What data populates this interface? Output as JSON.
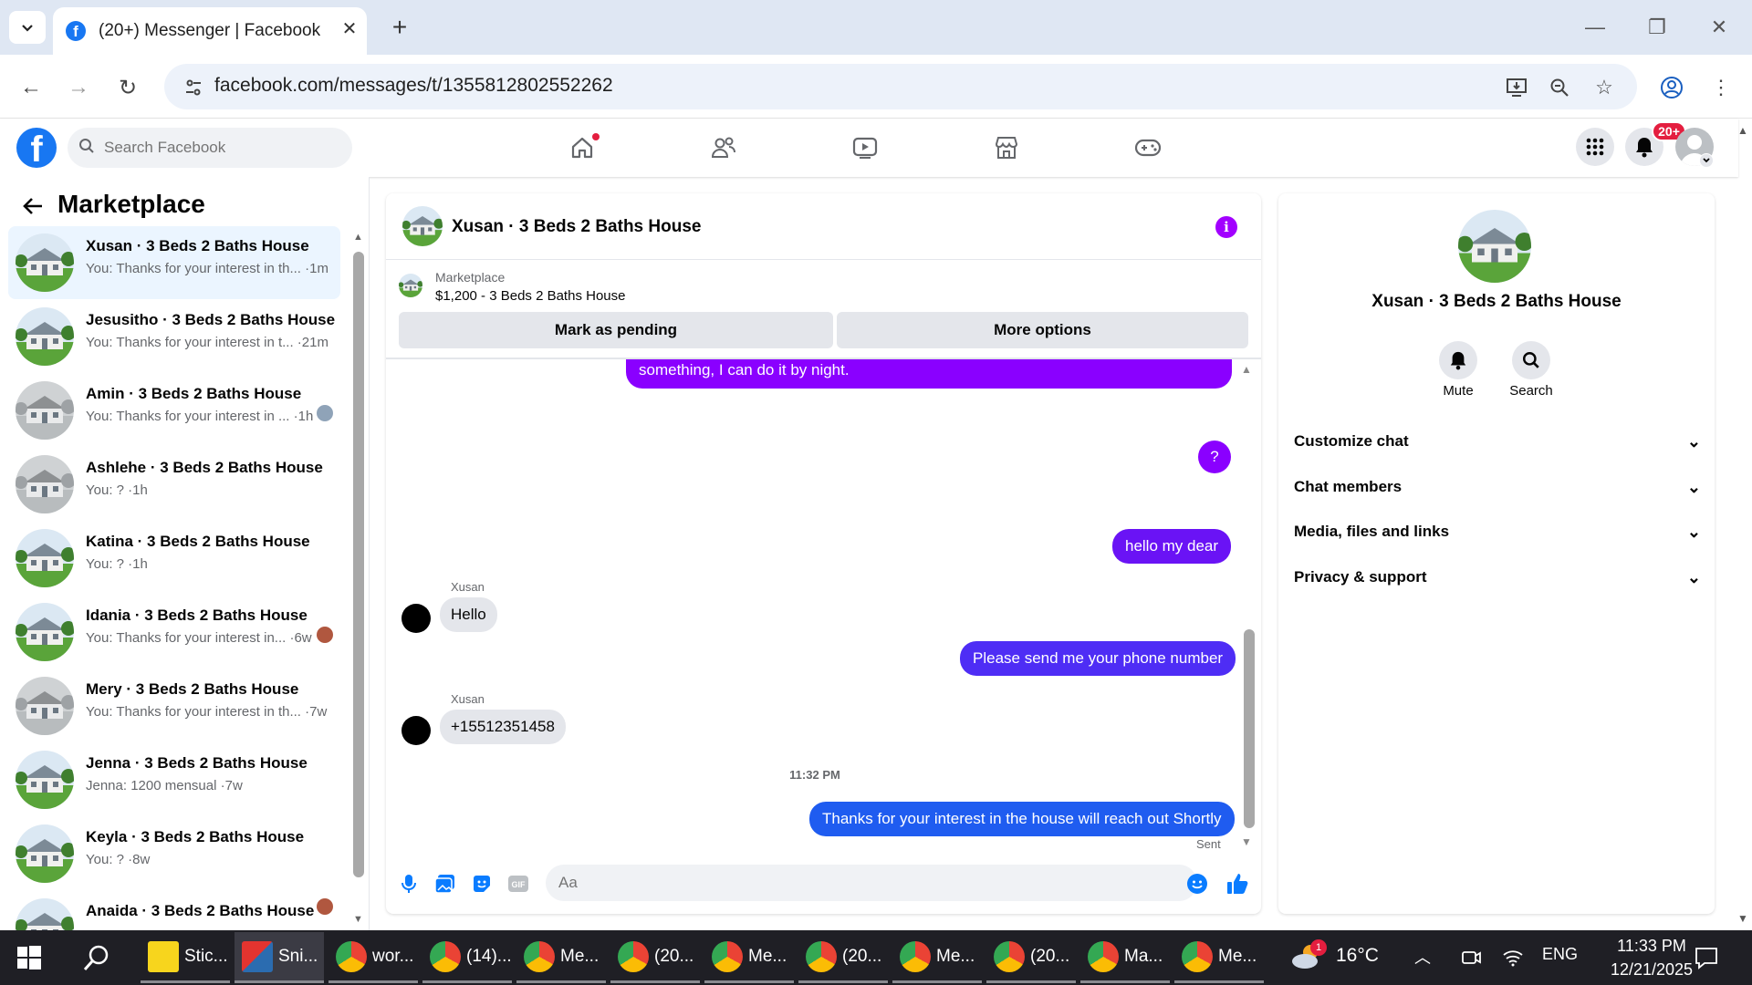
{
  "browser": {
    "tab_title": "(20+) Messenger | Facebook",
    "url": "facebook.com/messages/t/1355812802552262",
    "icons": [
      "tab-list-icon",
      "close-icon",
      "plus-icon",
      "minimize-icon",
      "restore-icon",
      "window-close-icon",
      "back-icon",
      "forward-icon",
      "reload-icon",
      "site-info-icon",
      "install-app-icon",
      "zoom-icon",
      "bookmark-star-icon",
      "profile-icon",
      "menu-kebab-icon"
    ]
  },
  "fb_header": {
    "logo": "f",
    "search_placeholder": "Search Facebook",
    "notification_count": "20+",
    "accent": "#1877f2",
    "badge_color": "#e41e3f"
  },
  "left": {
    "title": "Marketplace",
    "conversations": [
      {
        "name": "Xusan · 3 Beds 2 Baths House",
        "preview": "You: Thanks for your interest in th... ·1m",
        "active": true
      },
      {
        "name": "Jesusitho · 3 Beds 2 Baths House",
        "preview": "You: Thanks for your interest in t... ·21m"
      },
      {
        "name": "Amin · 3 Beds 2 Baths House",
        "preview": "You: Thanks for your interest in ... ·1h"
      },
      {
        "name": "Ashlehe · 3 Beds 2 Baths House",
        "preview": "You: ? ·1h"
      },
      {
        "name": "Katina · 3 Beds 2 Baths House",
        "preview": "You: ? ·1h"
      },
      {
        "name": "Idania · 3 Beds 2 Baths House",
        "preview": "You: Thanks for your interest in... ·6w"
      },
      {
        "name": "Mery · 3 Beds 2 Baths House",
        "preview": "You: Thanks for your interest in th... ·7w"
      },
      {
        "name": "Jenna · 3 Beds 2 Baths House",
        "preview": "Jenna: 1200 mensual ·7w"
      },
      {
        "name": "Keyla · 3 Beds 2 Baths House",
        "preview": "You: ? ·8w"
      },
      {
        "name": "Anaida · 3 Beds 2 Baths House",
        "preview": ""
      }
    ]
  },
  "chat": {
    "title": "Xusan · 3 Beds 2 Baths House",
    "listing_label": "Marketplace",
    "listing_price": "$1,200 - 3 Beds 2 Baths House",
    "mark_pending": "Mark as pending",
    "more_options": "More options",
    "messages": {
      "m1": "something, I can do it by night.",
      "m2": "?",
      "m3": "hello my dear",
      "sender1": "Xusan",
      "m4": "Hello",
      "m5": "Please send me your phone number",
      "sender2": "Xusan",
      "m6": "+15512351458",
      "timestamp": "11:32 PM",
      "m7": "Thanks for your interest in the house will reach out Shortly",
      "status": "Sent"
    },
    "composer_placeholder": "Aa",
    "bubble_color": "#8a00ff",
    "bubble_color_blue": "#4e2df5"
  },
  "right": {
    "name": "Xusan · 3 Beds 2 Baths House",
    "mute": "Mute",
    "search": "Search",
    "sections": [
      "Customize chat",
      "Chat members",
      "Media, files and links",
      "Privacy & support"
    ]
  },
  "taskbar": {
    "items": [
      "Stic...",
      "Sni...",
      "wor...",
      "(14)...",
      "Me...",
      "(20...",
      "Me...",
      "(20...",
      "Me...",
      "(20...",
      "Ma...",
      "Me..."
    ],
    "temperature": "16°C",
    "language": "ENG",
    "time": "11:33 PM",
    "date": "12/21/2025",
    "weather_badge": "1"
  }
}
